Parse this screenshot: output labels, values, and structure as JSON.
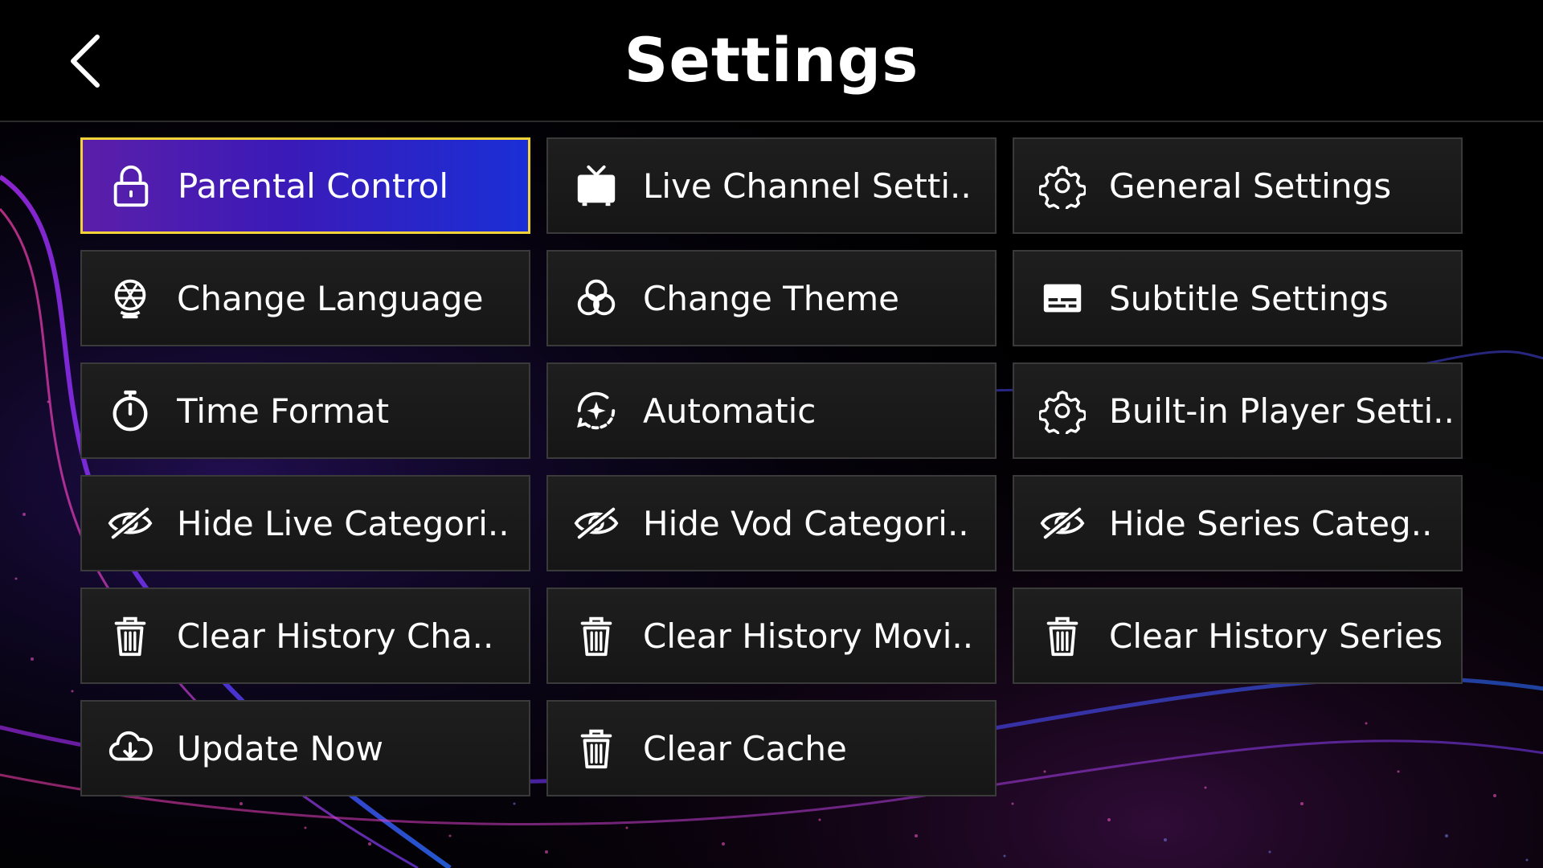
{
  "header": {
    "title": "Settings",
    "back_icon": "chevron-left-icon"
  },
  "accent": {
    "selected_border": "#f4d23a",
    "selected_gradient": [
      "#5b1fa9",
      "#1a2fd6"
    ]
  },
  "tiles": [
    {
      "label": "Parental Control",
      "icon": "lock-icon",
      "selected": true
    },
    {
      "label": "Live Channel Setti..",
      "icon": "tv-icon",
      "selected": false
    },
    {
      "label": "General Settings",
      "icon": "gear-icon",
      "selected": false
    },
    {
      "label": "Change Language",
      "icon": "globe-icon",
      "selected": false
    },
    {
      "label": "Change Theme",
      "icon": "theme-circles-icon",
      "selected": false
    },
    {
      "label": "Subtitle Settings",
      "icon": "subtitles-icon",
      "selected": false
    },
    {
      "label": "Time Format",
      "icon": "stopwatch-icon",
      "selected": false
    },
    {
      "label": "Automatic",
      "icon": "auto-sparkle-icon",
      "selected": false
    },
    {
      "label": "Built-in Player Setti..",
      "icon": "gear-icon",
      "selected": false
    },
    {
      "label": "Hide Live Categori..",
      "icon": "eye-off-icon",
      "selected": false
    },
    {
      "label": "Hide Vod Categori..",
      "icon": "eye-off-icon",
      "selected": false
    },
    {
      "label": "Hide Series Categ..",
      "icon": "eye-off-icon",
      "selected": false
    },
    {
      "label": "Clear History Cha..",
      "icon": "trash-icon",
      "selected": false
    },
    {
      "label": "Clear History Movi..",
      "icon": "trash-icon",
      "selected": false
    },
    {
      "label": "Clear History Series",
      "icon": "trash-icon",
      "selected": false
    },
    {
      "label": "Update Now",
      "icon": "cloud-download-icon",
      "selected": false
    },
    {
      "label": "Clear Cache",
      "icon": "trash-icon",
      "selected": false
    }
  ]
}
